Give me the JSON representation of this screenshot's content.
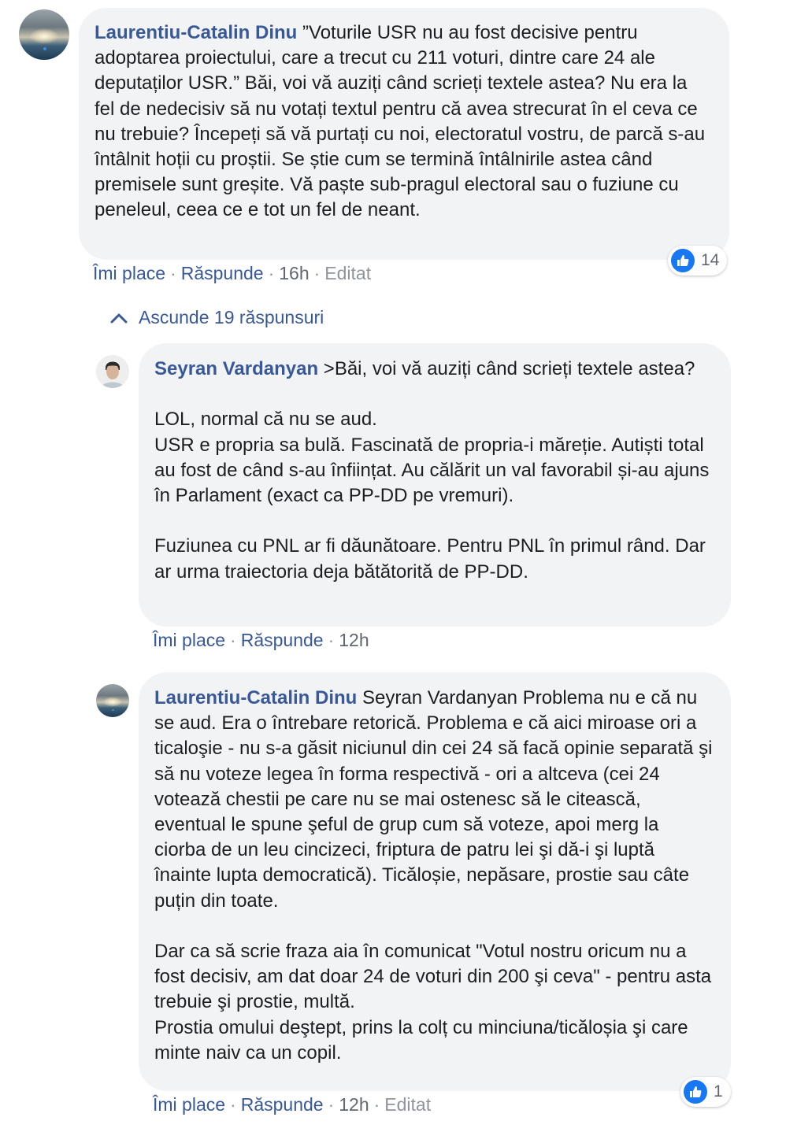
{
  "comments": [
    {
      "author": "Laurentiu-Catalin Dinu",
      "text": "”Voturile USR nu au fost decisive pentru adoptarea proiectului, care a trecut cu 211 voturi, dintre care 24 ale deputaților USR.” Băi, voi vă auziți când scrieți textele astea? Nu era la fel de nedecisiv să nu votați textul pentru că avea strecurat în el ceva ce nu trebuie? Începeți să vă purtați cu noi, electoratul vostru, de parcă s-au întâlnit hoții cu proștii. Se știe cum se termină întâlnirile astea când premisele sunt greșite. Vă paște sub-pragul electoral sau o fuziune cu peneleul, ceea ce e tot un fel de neant.",
      "like_label": "Îmi place",
      "reply_label": "Răspunde",
      "time": "16h",
      "edited": "Editat",
      "reactions": "14"
    }
  ],
  "replies_toggle": "Ascunde 19 răspunsuri",
  "replies": [
    {
      "author": "Seyran Vardanyan",
      "text": ">Băi, voi vă auziți când scrieți textele astea?\n\nLOL, normal că nu se aud.\nUSR e propria sa bulă. Fascinată de propria-i măreție. Autiști total au fost de când s-au înființat. Au călărit un val favorabil și-au ajuns în Parlament (exact ca PP-DD pe vremuri).\n\nFuziunea cu PNL ar fi dăunătoare. Pentru PNL în primul rând. Dar ar urma traiectoria deja bătătorită de PP-DD.",
      "like_label": "Îmi place",
      "reply_label": "Răspunde",
      "time": "12h"
    },
    {
      "author": "Laurentiu-Catalin Dinu",
      "text": "Seyran Vardanyan Problema nu e că nu se aud. Era o întrebare retorică. Problema e că aici miroase ori a ticaloşie - nu s-a găsit niciunul din cei 24 să facă opinie separată şi să nu voteze legea în forma respectivă - ori a altceva (cei 24 votează chestii pe care nu se mai ostenesc să le citească, eventual le spune şeful de grup cum să voteze, apoi merg la ciorba de un leu cincizeci, friptura de patru lei şi dă-i şi luptă înainte lupta democratică). Ticăloșie, nepăsare, prostie sau câte puțin din toate.\n\nDar ca să scrie fraza aia în comunicat \"Votul nostru oricum nu a fost decisiv, am dat doar 24 de voturi din 200 şi ceva\" - pentru asta trebuie şi prostie, multă.\nProstia omului deştept, prins la colț cu minciuna/ticăloșia şi care minte naiv ca un copil.",
      "like_label": "Îmi place",
      "reply_label": "Răspunde",
      "time": "12h",
      "edited": "Editat",
      "reactions": "1"
    }
  ],
  "colors": {
    "name": "#385898",
    "bubble": "#f2f3f5",
    "meta": "#90949c",
    "like": "#1877f2"
  },
  "icons": {
    "like": "thumbs-up-icon",
    "collapse": "chevron-up-icon"
  }
}
